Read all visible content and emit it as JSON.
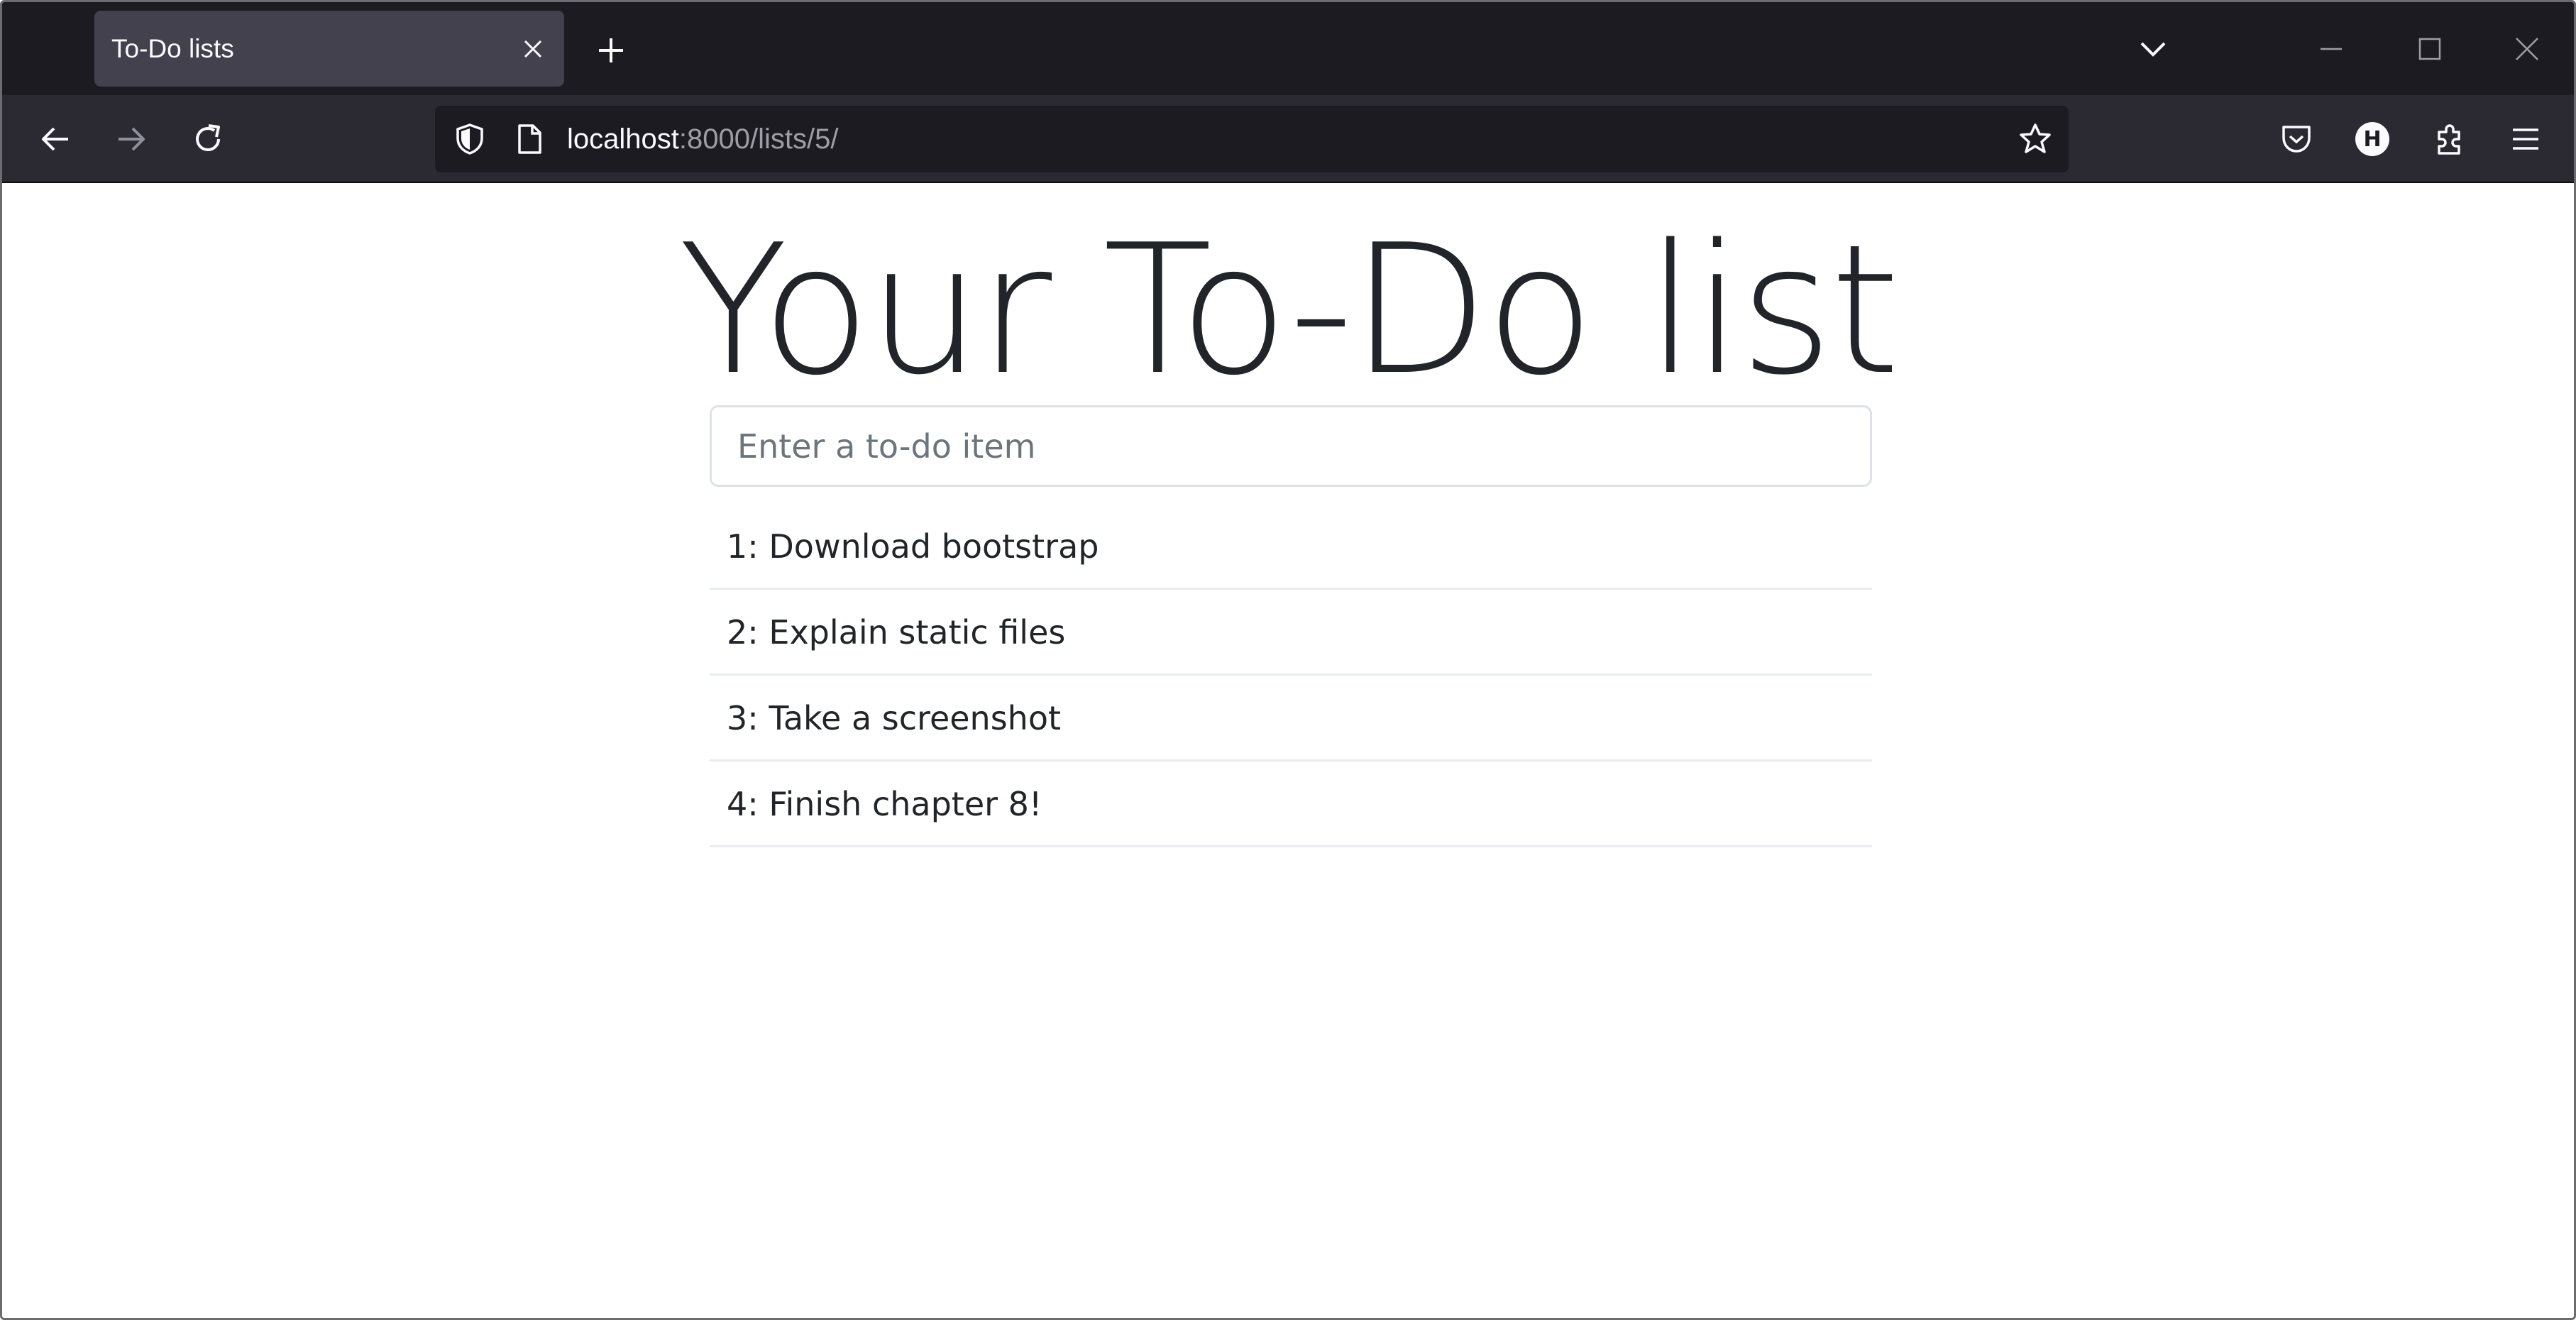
{
  "browser": {
    "tab": {
      "title": "To-Do lists"
    },
    "url": {
      "host": "localhost",
      "rest": ":8000/lists/5/"
    },
    "account_initial": "H",
    "icons": {
      "tab_close": "close-icon",
      "new_tab": "plus-icon",
      "tab_list": "chevron-down-icon",
      "minimize": "minimize-icon",
      "maximize": "maximize-icon",
      "window_close": "close-icon",
      "back": "arrow-left-icon",
      "forward": "arrow-right-icon",
      "reload": "reload-icon",
      "tracking_protection": "shield-icon",
      "page_info": "page-icon",
      "bookmark": "star-icon",
      "pocket": "pocket-icon",
      "extensions": "puzzle-icon",
      "menu": "hamburger-icon"
    },
    "colors": {
      "tabstrip_bg": "#1c1b22",
      "active_tab_bg": "#42414d",
      "navbar_bg": "#2b2a33",
      "urlbar_bg": "#1c1b22"
    }
  },
  "page": {
    "heading": "Your To-Do list",
    "input": {
      "placeholder": "Enter a to-do item",
      "value": ""
    },
    "items": [
      "1: Download bootstrap",
      "2: Explain static files",
      "3: Take a screenshot",
      "4: Finish chapter 8!"
    ]
  }
}
